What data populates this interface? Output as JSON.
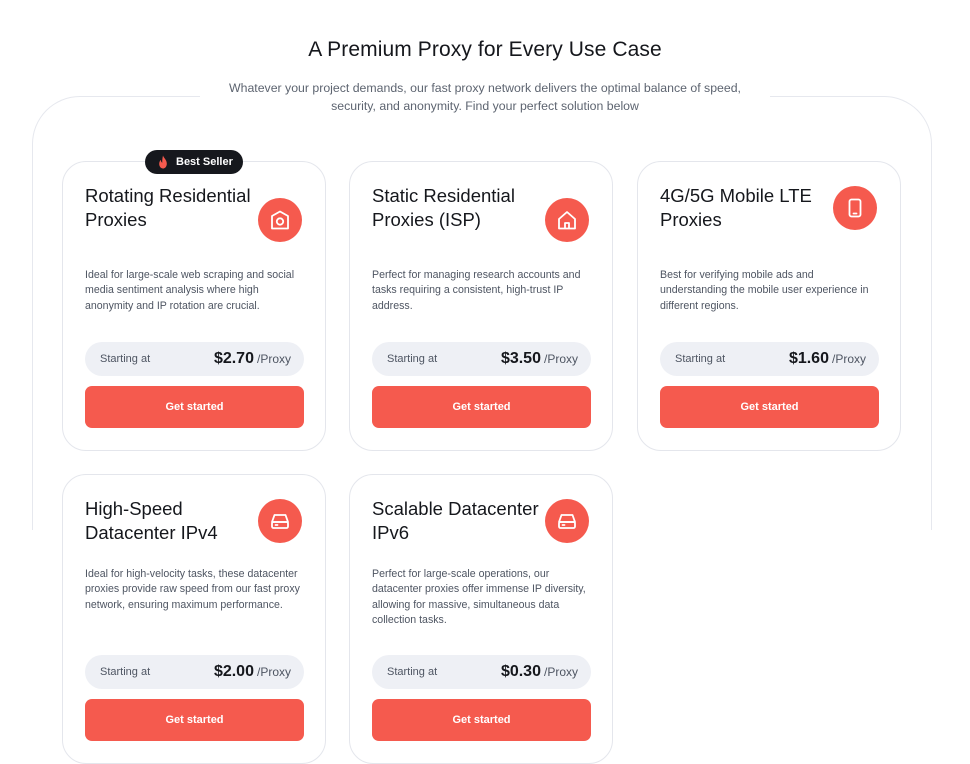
{
  "header": {
    "title": "A Premium Proxy for Every Use Case",
    "subtitle": "Whatever your project demands, our fast proxy network delivers the optimal balance of speed, security, and anonymity. Find your perfect solution below"
  },
  "theme": {
    "accent": "#f55a4e",
    "badge_bg": "#16181d",
    "price_bg": "#eef0f5"
  },
  "cards": [
    {
      "badge": "Best Seller",
      "badge_icon": "flame-icon",
      "title": "Rotating Residential Proxies",
      "icon": "house-location-icon",
      "description": "Ideal for large-scale web scraping and social media sentiment analysis where high anonymity and IP rotation are crucial.",
      "price_label": "Starting at",
      "price": "$2.70",
      "unit": "/Proxy",
      "cta": "Get started"
    },
    {
      "title": "Static Residential Proxies (ISP)",
      "icon": "house-icon",
      "description": "Perfect for managing research accounts and tasks requiring a consistent, high-trust IP address.",
      "price_label": "Starting at",
      "price": "$3.50",
      "unit": "/Proxy",
      "cta": "Get started"
    },
    {
      "title": "4G/5G Mobile LTE Proxies",
      "icon": "mobile-icon",
      "description": "Best for verifying mobile ads and understanding the mobile user experience in different regions.",
      "price_label": "Starting at",
      "price": "$1.60",
      "unit": "/Proxy",
      "cta": "Get started"
    },
    {
      "title": "High-Speed Datacenter IPv4",
      "icon": "server-drive-icon",
      "description": "Ideal for high-velocity tasks, these datacenter proxies provide raw speed from our fast proxy network, ensuring maximum performance.",
      "price_label": "Starting at",
      "price": "$2.00",
      "unit": "/Proxy",
      "cta": "Get started"
    },
    {
      "title": "Scalable Datacenter IPv6",
      "icon": "server-drive-icon",
      "description": "Perfect for large-scale operations, our datacenter proxies offer immense IP diversity, allowing for massive, simultaneous data collection tasks.",
      "price_label": "Starting at",
      "price": "$0.30",
      "unit": "/Proxy",
      "cta": "Get started"
    }
  ]
}
